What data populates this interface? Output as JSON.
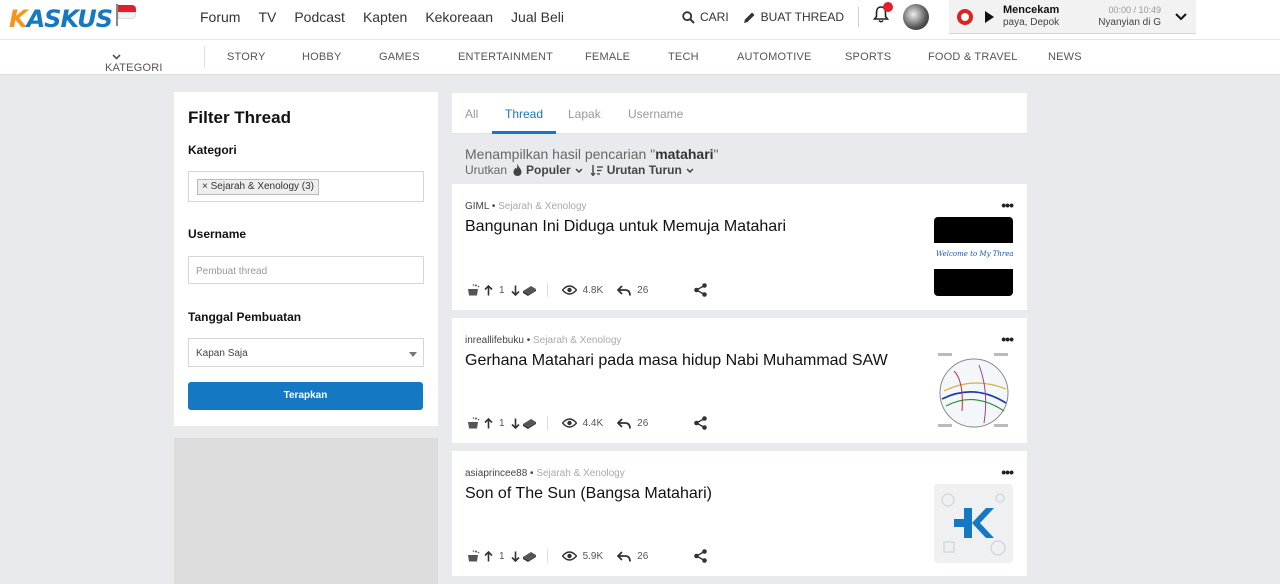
{
  "header": {
    "logo": "KASKUS",
    "nav": [
      "Forum",
      "TV",
      "Podcast",
      "Kapten",
      "Kekoreaan",
      "Jual Beli"
    ],
    "search_label": "CARI",
    "create_label": "BUAT THREAD",
    "player": {
      "song": "Mencekam",
      "time": "00:00 / 10:49",
      "artist": "paya, Depok",
      "station": "Nyanyian di G"
    }
  },
  "categories": {
    "label": "KATEGORI",
    "items": [
      "STORY",
      "HOBBY",
      "GAMES",
      "ENTERTAINMENT",
      "FEMALE",
      "TECH",
      "AUTOMOTIVE",
      "SPORTS",
      "FOOD & TRAVEL",
      "NEWS"
    ]
  },
  "filter": {
    "title": "Filter Thread",
    "kategori_label": "Kategori",
    "kategori_chip": "× Sejarah & Xenology (3)",
    "username_label": "Username",
    "username_placeholder": "Pembuat thread",
    "tanggal_label": "Tanggal Pembuatan",
    "tanggal_value": "Kapan Saja",
    "apply_label": "Terapkan"
  },
  "results": {
    "tabs": [
      "All",
      "Thread",
      "Lapak",
      "Username"
    ],
    "active_tab": "Thread",
    "summary_prefix": "Menampilkan hasil pencarian \"",
    "query": "matahari",
    "summary_suffix": "\"",
    "sort_label": "Urutkan",
    "sort_value": "Populer",
    "order_value": "Urutan Turun",
    "threads": [
      {
        "author": "GIML",
        "category": "Sejarah & Xenology",
        "title": "Bangunan Ini Diduga untuk Memuja Matahari",
        "votes": "1",
        "views": "4.8K",
        "replies": "26",
        "thumb_text": "Welcome to My Thread"
      },
      {
        "author": "inreallifebuku",
        "category": "Sejarah & Xenology",
        "title": "Gerhana Matahari pada masa hidup Nabi Muhammad SAW",
        "votes": "1",
        "views": "4.4K",
        "replies": "26"
      },
      {
        "author": "asiaprincee88",
        "category": "Sejarah & Xenology",
        "title": "Son of The Sun (Bangsa Matahari)",
        "votes": "1",
        "views": "5.9K",
        "replies": "26"
      }
    ]
  },
  "colors": {
    "brand": "#1478c3",
    "accent": "#f7941d",
    "alert": "#e0202d"
  }
}
